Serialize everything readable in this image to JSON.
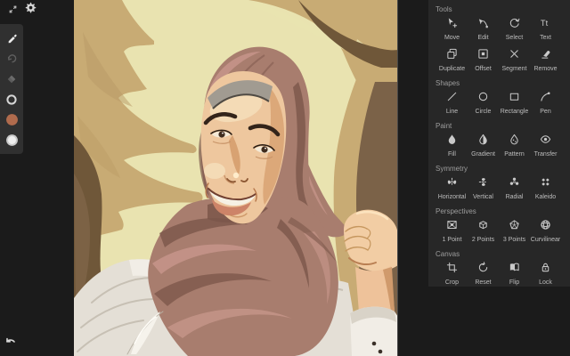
{
  "topbar": {
    "icons": [
      {
        "icon": "collapse"
      },
      {
        "icon": "settings-gear"
      }
    ]
  },
  "left_toolbar": {
    "tools": [
      {
        "icon": "pencil",
        "active": true
      },
      {
        "icon": "redo",
        "active": false
      },
      {
        "icon": "eraser",
        "active": false
      },
      {
        "icon": "stroke-ring",
        "active": true
      },
      {
        "icon": "color-swatch-primary",
        "color": "#b06b4d"
      },
      {
        "icon": "color-swatch-secondary",
        "color": "#d9d9d9"
      }
    ]
  },
  "undo": {
    "icon": "undo-arrow"
  },
  "panel": {
    "background": "#272727",
    "sections": [
      {
        "title": "Tools",
        "items": [
          {
            "label": "Move",
            "icon": "move"
          },
          {
            "label": "Edit",
            "icon": "edit"
          },
          {
            "label": "Select",
            "icon": "select"
          },
          {
            "label": "Text",
            "icon": "text"
          },
          {
            "label": "Duplicate",
            "icon": "duplicate"
          },
          {
            "label": "Offset",
            "icon": "offset"
          },
          {
            "label": "Segment",
            "icon": "segment"
          },
          {
            "label": "Remove",
            "icon": "remove"
          }
        ]
      },
      {
        "title": "Shapes",
        "items": [
          {
            "label": "Line",
            "icon": "line"
          },
          {
            "label": "Circle",
            "icon": "circle"
          },
          {
            "label": "Rectangle",
            "icon": "rectangle"
          },
          {
            "label": "Pen",
            "icon": "pen"
          }
        ]
      },
      {
        "title": "Paint",
        "items": [
          {
            "label": "Fill",
            "icon": "fill"
          },
          {
            "label": "Gradient",
            "icon": "gradient"
          },
          {
            "label": "Pattern",
            "icon": "pattern"
          },
          {
            "label": "Transfer",
            "icon": "transfer"
          }
        ]
      },
      {
        "title": "Symmetry",
        "items": [
          {
            "label": "Horizontal",
            "icon": "symmetry-horizontal"
          },
          {
            "label": "Vertical",
            "icon": "symmetry-vertical"
          },
          {
            "label": "Radial",
            "icon": "symmetry-radial"
          },
          {
            "label": "Kaleido",
            "icon": "symmetry-kaleido"
          }
        ]
      },
      {
        "title": "Perspectives",
        "items": [
          {
            "label": "1 Point",
            "icon": "perspective-1point"
          },
          {
            "label": "2 Points",
            "icon": "perspective-2points"
          },
          {
            "label": "3 Points",
            "icon": "perspective-3points"
          },
          {
            "label": "Curvilinear",
            "icon": "perspective-curvilinear"
          }
        ]
      },
      {
        "title": "Canvas",
        "items": [
          {
            "label": "Crop",
            "icon": "crop"
          },
          {
            "label": "Reset",
            "icon": "reset"
          },
          {
            "label": "Flip",
            "icon": "flip"
          },
          {
            "label": "Lock",
            "icon": "lock"
          }
        ]
      }
    ]
  },
  "artwork": {
    "subject": "vector portrait of smiling woman wearing hijab",
    "colors": {
      "background": "#e9e3b0",
      "tan_shapes": "#c8ab74",
      "dark_brown": "#6f5739",
      "right_brown": "#7b6248",
      "hijab_base": "#a87d6e",
      "hijab_light": "#c49488",
      "hijab_dark": "#7b564a",
      "skin": "#eec79e",
      "skin_shadow": "#d8a272",
      "garment": "#e4dfd6"
    }
  }
}
